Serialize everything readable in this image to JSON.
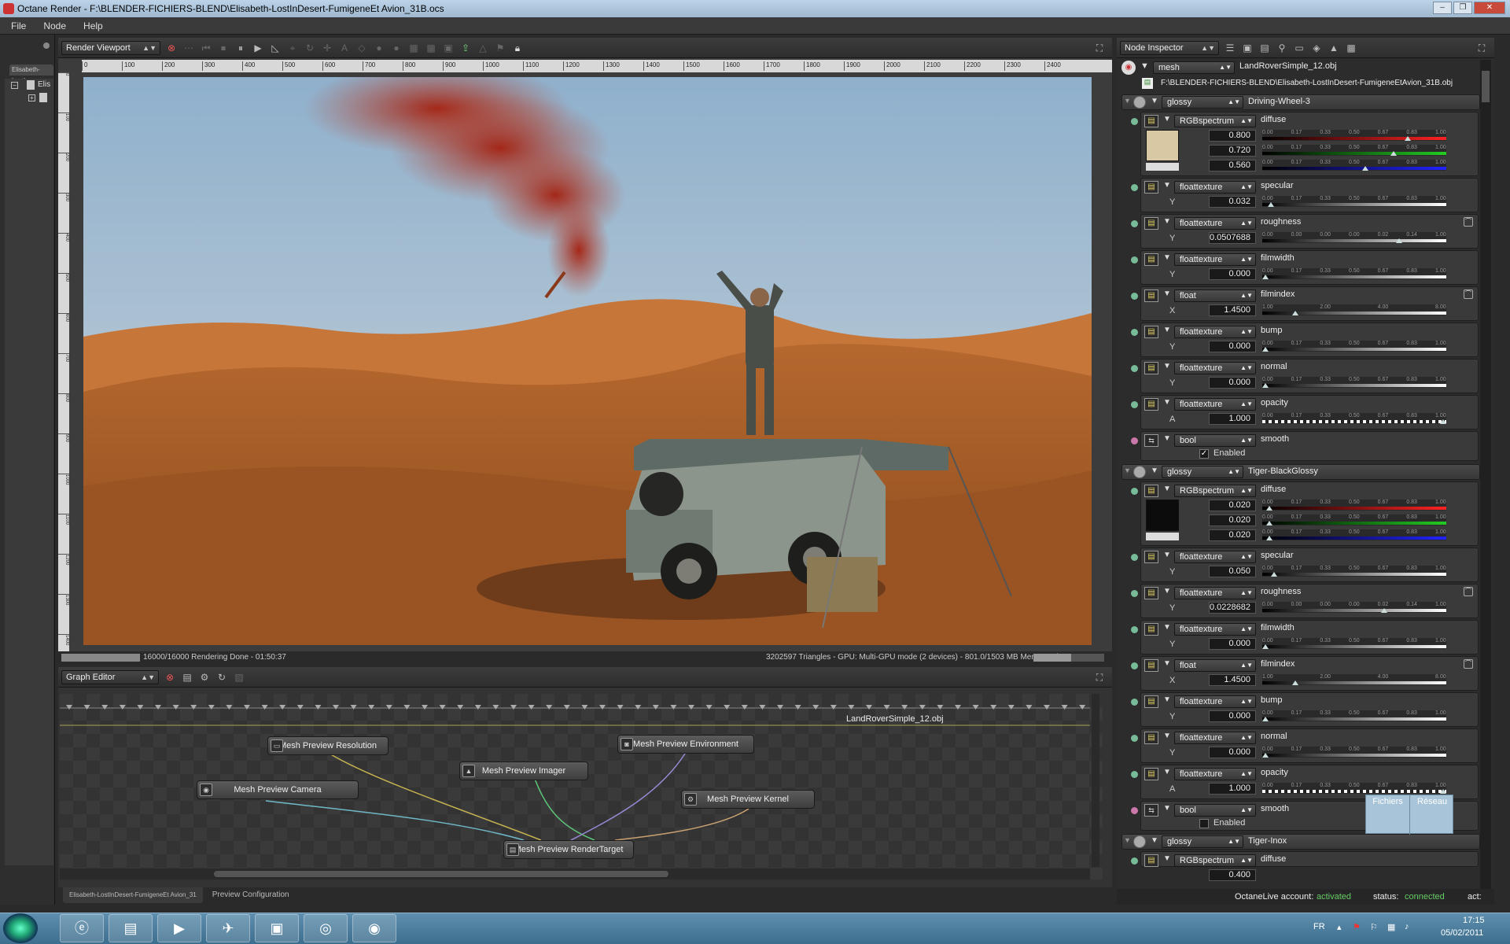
{
  "window": {
    "title": "Octane Render - F:\\BLENDER-FICHIERS-BLEND\\Elisabeth-LostInDesert-FumigeneEt Avion_31B.ocs",
    "buttons": [
      "–",
      "❐",
      "✕"
    ]
  },
  "menu": [
    "File",
    "Node",
    "Help"
  ],
  "left_panel": {
    "tab": "Elisabeth-LostIn",
    "tree_item": "Elis"
  },
  "viewport": {
    "mode_label": "Render Viewport",
    "ruler_ticks": [
      "0",
      "100",
      "200",
      "300",
      "400",
      "500",
      "600",
      "700",
      "800",
      "900",
      "1000",
      "1100",
      "1200",
      "1300",
      "1400",
      "1500",
      "1600",
      "1700",
      "1800",
      "1900",
      "2000",
      "2100",
      "2200",
      "2300",
      "2400"
    ],
    "ruler_v_ticks": [
      "0",
      "100",
      "200",
      "300",
      "400",
      "500",
      "600",
      "700",
      "800",
      "900",
      "1000",
      "1100",
      "1200",
      "1300",
      "1400"
    ],
    "status_left": "16000/16000 Rendering Done - 01:50:37",
    "status_right": "3202597 Triangles - GPU: Multi-GPU mode (2 devices) - 801.0/1503 MB Mem Used",
    "mem_progress": 0.53
  },
  "graph_editor": {
    "mode_label": "Graph Editor",
    "mesh_node": "LandRoverSimple_12.obj",
    "nodes": {
      "resolution": "Mesh Preview Resolution",
      "environment": "Mesh Preview Environment",
      "imager": "Mesh Preview Imager",
      "camera": "Mesh Preview Camera",
      "kernel": "Mesh Preview Kernel",
      "rendertarget": "Mesh Preview RenderTarget"
    },
    "tabs": [
      "Elisabeth-LostInDesert-FumigeneEt Avion_31",
      "Preview Configuration"
    ]
  },
  "inspector": {
    "mode_label": "Node Inspector",
    "node_type": "mesh",
    "node_name": "LandRoverSimple_12.obj",
    "path": "F:\\BLENDER-FICHIERS-BLEND\\Elisabeth-LostInDesert-FumigeneEtAvion_31B.obj",
    "slider_ticks": [
      "0.00",
      "0.17",
      "0.33",
      "0.50",
      "0.67",
      "0.83",
      "1.00"
    ],
    "slider_ticks_rough": [
      "0.00",
      "0.00",
      "0.00",
      "0.00",
      "0.02",
      "0.14",
      "1.00"
    ],
    "slider_ticks_index": [
      "1.00",
      "2.00",
      "4.00",
      "8.00"
    ],
    "materials": [
      {
        "type": "glossy",
        "name": "Driving-Wheel-3",
        "diffuse": {
          "type": "RGBspectrum",
          "label": "diffuse",
          "r": "0.800",
          "g": "0.720",
          "b": "0.560",
          "swatch": "#d8c8a4"
        },
        "params": [
          {
            "type": "floattexture",
            "label": "specular",
            "axis": "Y",
            "value": "0.032",
            "pos": 0.032
          },
          {
            "type": "floattexture",
            "label": "roughness",
            "axis": "Y",
            "value": "0.0507688",
            "pos": 0.75
          },
          {
            "type": "floattexture",
            "label": "filmwidth",
            "axis": "Y",
            "value": "0.000",
            "pos": 0
          },
          {
            "type": "float",
            "label": "filmindex",
            "axis": "X",
            "value": "1.4500",
            "pos": 0.17
          },
          {
            "type": "floattexture",
            "label": "bump",
            "axis": "Y",
            "value": "0.000",
            "pos": 0
          },
          {
            "type": "floattexture",
            "label": "normal",
            "axis": "Y",
            "value": "0.000",
            "pos": 0
          },
          {
            "type": "floattexture",
            "label": "opacity",
            "axis": "A",
            "value": "1.000",
            "pos": 1
          }
        ],
        "bool": {
          "type": "bool",
          "label": "smooth",
          "check_label": "Enabled",
          "checked": true
        }
      },
      {
        "type": "glossy",
        "name": "Tiger-BlackGlossy",
        "diffuse": {
          "type": "RGBspectrum",
          "label": "diffuse",
          "r": "0.020",
          "g": "0.020",
          "b": "0.020",
          "swatch": "#0c0c0c"
        },
        "params": [
          {
            "type": "floattexture",
            "label": "specular",
            "axis": "Y",
            "value": "0.050",
            "pos": 0.05
          },
          {
            "type": "floattexture",
            "label": "roughness",
            "axis": "Y",
            "value": "0.0228682",
            "pos": 0.67
          },
          {
            "type": "floattexture",
            "label": "filmwidth",
            "axis": "Y",
            "value": "0.000",
            "pos": 0
          },
          {
            "type": "float",
            "label": "filmindex",
            "axis": "X",
            "value": "1.4500",
            "pos": 0.17
          },
          {
            "type": "floattexture",
            "label": "bump",
            "axis": "Y",
            "value": "0.000",
            "pos": 0
          },
          {
            "type": "floattexture",
            "label": "normal",
            "axis": "Y",
            "value": "0.000",
            "pos": 0
          },
          {
            "type": "floattexture",
            "label": "opacity",
            "axis": "A",
            "value": "1.000",
            "pos": 1
          }
        ],
        "bool": {
          "type": "bool",
          "label": "smooth",
          "check_label": "Enabled",
          "checked": false
        }
      },
      {
        "type": "glossy",
        "name": "Tiger-Inox",
        "diffuse": {
          "type": "RGBspectrum",
          "label": "diffuse",
          "r": "0.400"
        }
      }
    ],
    "popup": [
      "Fichiers",
      "Réseau"
    ],
    "status": {
      "account_label": "OctaneLive account:",
      "account_value": "activated",
      "status_label": "status:",
      "status_value": "connected",
      "act_label": "act:"
    }
  },
  "taskbar": {
    "lang": "FR",
    "time": "17:15",
    "date": "05/02/2011"
  }
}
